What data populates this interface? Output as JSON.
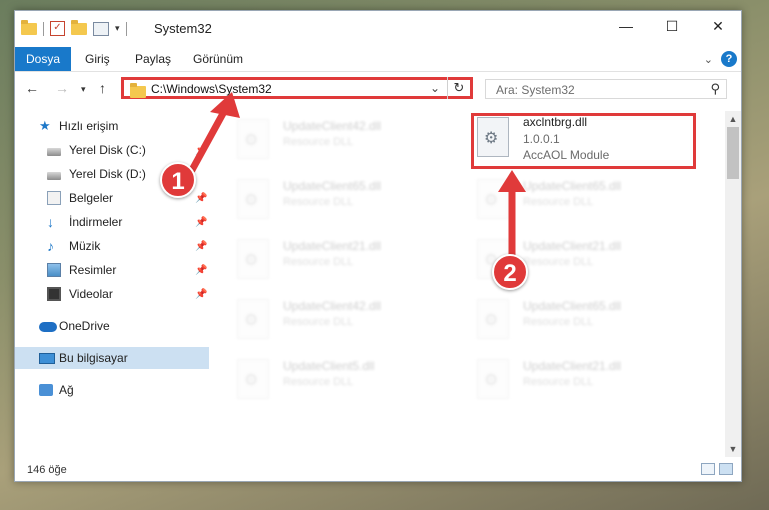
{
  "window": {
    "title": "System32",
    "quick_access_arrow": "▾"
  },
  "ribbon": {
    "tabs": [
      "Dosya",
      "Giriş",
      "Paylaş",
      "Görünüm"
    ]
  },
  "address": {
    "path": "C:\\Windows\\System32"
  },
  "search": {
    "placeholder": "Ara: System32"
  },
  "sidebar": {
    "items": [
      {
        "label": "Hızlı erişim",
        "icon": "star-icon"
      },
      {
        "label": "Yerel Disk (C:)",
        "icon": "drive-icon"
      },
      {
        "label": "Yerel Disk (D:)",
        "icon": "drive-icon"
      },
      {
        "label": "Belgeler",
        "icon": "documents-icon"
      },
      {
        "label": "İndirmeler",
        "icon": "downloads-icon"
      },
      {
        "label": "Müzik",
        "icon": "music-icon"
      },
      {
        "label": "Resimler",
        "icon": "pictures-icon"
      },
      {
        "label": "Videolar",
        "icon": "videos-icon"
      },
      {
        "label": "OneDrive",
        "icon": "cloud-icon"
      },
      {
        "label": "Bu bilgisayar",
        "icon": "computer-icon"
      },
      {
        "label": "Ağ",
        "icon": "network-icon"
      }
    ]
  },
  "files": {
    "left": [
      {
        "name": "UpdateClient42.dll",
        "desc": "Resource DLL"
      },
      {
        "name": "UpdateClient65.dll",
        "desc": "Resource DLL"
      },
      {
        "name": "UpdateClient21.dll",
        "desc": "Resource DLL"
      },
      {
        "name": "UpdateClient42.dll",
        "desc": "Resource DLL"
      },
      {
        "name": "UpdateClient5.dll",
        "desc": "Resource DLL"
      }
    ],
    "right": [
      {
        "name": "UpdateClient65.dll",
        "desc": "Resource DLL"
      },
      {
        "name": "UpdateClient21.dll",
        "desc": "Resource DLL"
      },
      {
        "name": "UpdateClient65.dll",
        "desc": "Resource DLL"
      },
      {
        "name": "UpdateClient21.dll",
        "desc": "Resource DLL"
      }
    ],
    "highlighted": {
      "name": "axclntbrg.dll",
      "version": "1.0.0.1",
      "desc": "AccAOL Module"
    }
  },
  "status": {
    "count": "146 öğe"
  },
  "annotations": {
    "badge1": "1",
    "badge2": "2",
    "color": "#e03a3a"
  }
}
